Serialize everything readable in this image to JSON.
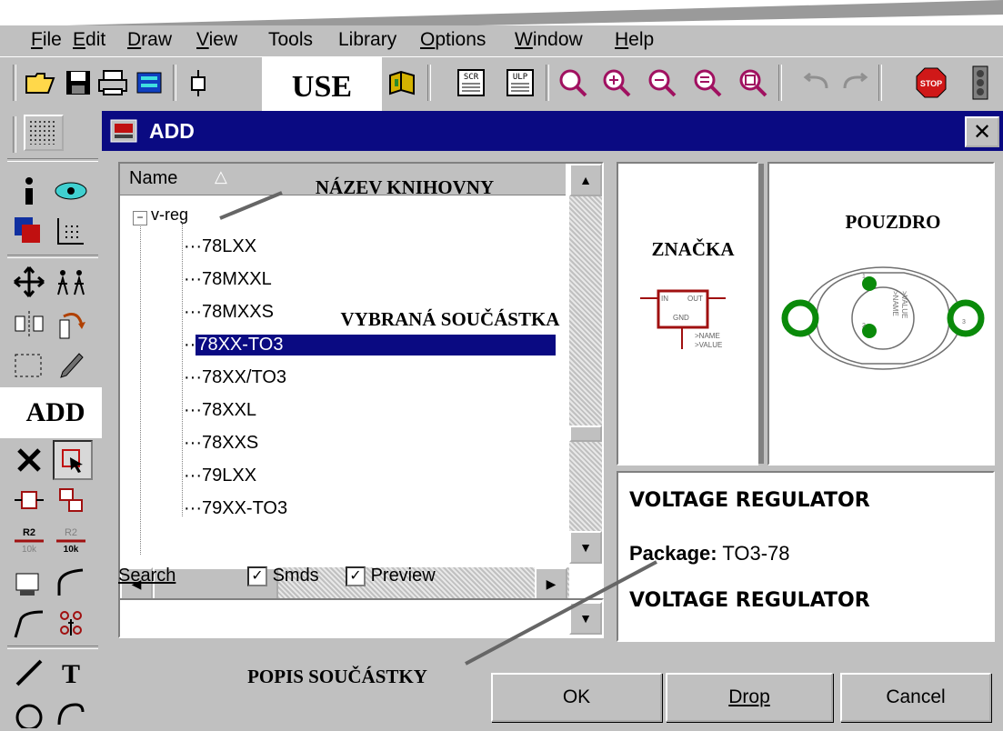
{
  "menubar": {
    "items": [
      {
        "pre": "",
        "ul": "F",
        "post": "ile"
      },
      {
        "pre": "",
        "ul": "E",
        "post": "dit"
      },
      {
        "pre": "",
        "ul": "D",
        "post": "raw"
      },
      {
        "pre": "",
        "ul": "V",
        "post": "iew"
      },
      {
        "pre": "Tools",
        "ul": "",
        "post": ""
      },
      {
        "pre": "Library",
        "ul": "",
        "post": ""
      },
      {
        "pre": "",
        "ul": "O",
        "post": "ptions"
      },
      {
        "pre": "",
        "ul": "W",
        "post": "indow"
      },
      {
        "pre": "",
        "ul": "H",
        "post": "elp"
      }
    ]
  },
  "toolbar": {
    "icons": [
      "open-folder-icon",
      "save-icon",
      "print-icon",
      "cam-icon",
      "use-icon",
      "library-book-icon",
      "script-icon",
      "ulp-icon",
      "zoom-fit-icon",
      "zoom-in-icon",
      "zoom-out-icon",
      "zoom-redraw-icon",
      "zoom-select-icon",
      "undo-icon",
      "redo-icon",
      "stop-icon",
      "go-icon"
    ],
    "script_label": "SCR",
    "ulp_label": "ULP",
    "stop_label": "STOP"
  },
  "annotations": {
    "use": "USE",
    "add": "ADD",
    "library_name": "NÁZEV KNIHOVNY",
    "selected_part": "VYBRANÁ SOUČÁSTKA",
    "symbol": "ZNAČKA",
    "package": "POUZDRO",
    "part_description": "POPIS SOUČÁSTKY"
  },
  "palette": {
    "icons": [
      "info-icon",
      "show-icon",
      "layers-icon",
      "grid-icon",
      "move-icon",
      "group-icon",
      "mirror-icon",
      "rotate-icon",
      "copy-icon",
      "change-icon",
      "delete-icon",
      "add-icon",
      "pinswap-icon",
      "gateswap-icon",
      "name-icon",
      "value-icon",
      "split-icon",
      "miter-icon",
      "wire-icon",
      "text-icon",
      "circle-icon",
      "arc-icon"
    ],
    "name_label": "R2",
    "value_label": "10k"
  },
  "dialog": {
    "title": "ADD",
    "tree": {
      "header": "Name",
      "root": "v-reg",
      "items": [
        "78LXX",
        "78MXXL",
        "78MXXS",
        "78XX-TO3",
        "78XX/TO3",
        "78XXL",
        "78XXS",
        "79LXX",
        "79XX-TO3"
      ],
      "selected_index": 3
    },
    "search_label": "Search",
    "smds_label": "Smds",
    "preview_label": "Preview",
    "search_value": "",
    "symbol_preview": {
      "pin_in": "IN",
      "pin_out": "OUT",
      "pin_gnd": "GND",
      "name_text": ">NAME",
      "value_text": ">VALUE"
    },
    "package_preview": {
      "name_text": ">NAME",
      "value_text": ">VALUE",
      "pin1": "1",
      "pin2": "2",
      "pin3": "3"
    },
    "description": {
      "line1": "VOLTAGE REGULATOR",
      "package_key": "Package:",
      "package_value": "TO3-78",
      "line3": "VOLTAGE REGULATOR"
    },
    "buttons": {
      "ok": "OK",
      "drop": "Drop",
      "cancel": "Cancel"
    }
  },
  "colors": {
    "title_bar": "#0a0a82",
    "selection": "#0a0a82",
    "symbol_red": "#a01010",
    "pad_green": "#0a8a0a"
  }
}
